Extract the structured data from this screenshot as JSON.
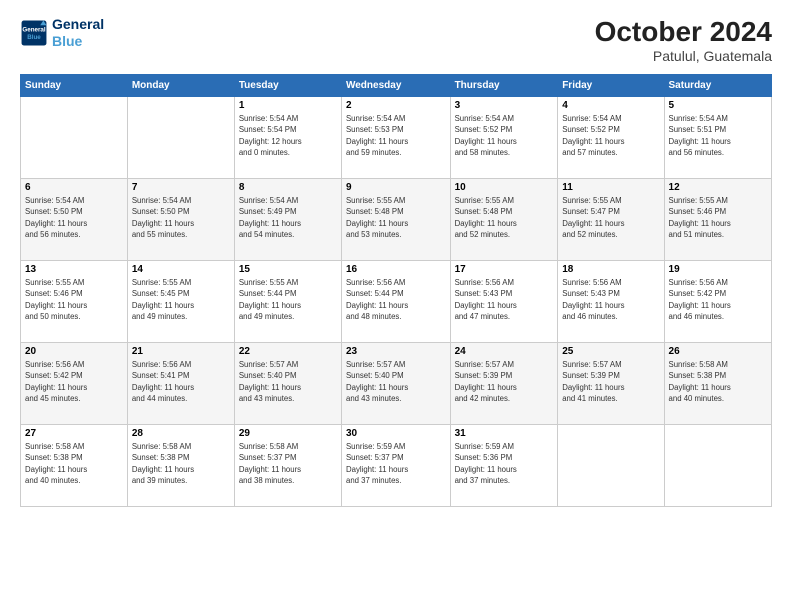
{
  "header": {
    "logo_line1": "General",
    "logo_line2": "Blue",
    "month": "October 2024",
    "location": "Patulul, Guatemala"
  },
  "weekdays": [
    "Sunday",
    "Monday",
    "Tuesday",
    "Wednesday",
    "Thursday",
    "Friday",
    "Saturday"
  ],
  "weeks": [
    [
      {
        "day": "",
        "info": ""
      },
      {
        "day": "",
        "info": ""
      },
      {
        "day": "1",
        "info": "Sunrise: 5:54 AM\nSunset: 5:54 PM\nDaylight: 12 hours\nand 0 minutes."
      },
      {
        "day": "2",
        "info": "Sunrise: 5:54 AM\nSunset: 5:53 PM\nDaylight: 11 hours\nand 59 minutes."
      },
      {
        "day": "3",
        "info": "Sunrise: 5:54 AM\nSunset: 5:52 PM\nDaylight: 11 hours\nand 58 minutes."
      },
      {
        "day": "4",
        "info": "Sunrise: 5:54 AM\nSunset: 5:52 PM\nDaylight: 11 hours\nand 57 minutes."
      },
      {
        "day": "5",
        "info": "Sunrise: 5:54 AM\nSunset: 5:51 PM\nDaylight: 11 hours\nand 56 minutes."
      }
    ],
    [
      {
        "day": "6",
        "info": "Sunrise: 5:54 AM\nSunset: 5:50 PM\nDaylight: 11 hours\nand 56 minutes."
      },
      {
        "day": "7",
        "info": "Sunrise: 5:54 AM\nSunset: 5:50 PM\nDaylight: 11 hours\nand 55 minutes."
      },
      {
        "day": "8",
        "info": "Sunrise: 5:54 AM\nSunset: 5:49 PM\nDaylight: 11 hours\nand 54 minutes."
      },
      {
        "day": "9",
        "info": "Sunrise: 5:55 AM\nSunset: 5:48 PM\nDaylight: 11 hours\nand 53 minutes."
      },
      {
        "day": "10",
        "info": "Sunrise: 5:55 AM\nSunset: 5:48 PM\nDaylight: 11 hours\nand 52 minutes."
      },
      {
        "day": "11",
        "info": "Sunrise: 5:55 AM\nSunset: 5:47 PM\nDaylight: 11 hours\nand 52 minutes."
      },
      {
        "day": "12",
        "info": "Sunrise: 5:55 AM\nSunset: 5:46 PM\nDaylight: 11 hours\nand 51 minutes."
      }
    ],
    [
      {
        "day": "13",
        "info": "Sunrise: 5:55 AM\nSunset: 5:46 PM\nDaylight: 11 hours\nand 50 minutes."
      },
      {
        "day": "14",
        "info": "Sunrise: 5:55 AM\nSunset: 5:45 PM\nDaylight: 11 hours\nand 49 minutes."
      },
      {
        "day": "15",
        "info": "Sunrise: 5:55 AM\nSunset: 5:44 PM\nDaylight: 11 hours\nand 49 minutes."
      },
      {
        "day": "16",
        "info": "Sunrise: 5:56 AM\nSunset: 5:44 PM\nDaylight: 11 hours\nand 48 minutes."
      },
      {
        "day": "17",
        "info": "Sunrise: 5:56 AM\nSunset: 5:43 PM\nDaylight: 11 hours\nand 47 minutes."
      },
      {
        "day": "18",
        "info": "Sunrise: 5:56 AM\nSunset: 5:43 PM\nDaylight: 11 hours\nand 46 minutes."
      },
      {
        "day": "19",
        "info": "Sunrise: 5:56 AM\nSunset: 5:42 PM\nDaylight: 11 hours\nand 46 minutes."
      }
    ],
    [
      {
        "day": "20",
        "info": "Sunrise: 5:56 AM\nSunset: 5:42 PM\nDaylight: 11 hours\nand 45 minutes."
      },
      {
        "day": "21",
        "info": "Sunrise: 5:56 AM\nSunset: 5:41 PM\nDaylight: 11 hours\nand 44 minutes."
      },
      {
        "day": "22",
        "info": "Sunrise: 5:57 AM\nSunset: 5:40 PM\nDaylight: 11 hours\nand 43 minutes."
      },
      {
        "day": "23",
        "info": "Sunrise: 5:57 AM\nSunset: 5:40 PM\nDaylight: 11 hours\nand 43 minutes."
      },
      {
        "day": "24",
        "info": "Sunrise: 5:57 AM\nSunset: 5:39 PM\nDaylight: 11 hours\nand 42 minutes."
      },
      {
        "day": "25",
        "info": "Sunrise: 5:57 AM\nSunset: 5:39 PM\nDaylight: 11 hours\nand 41 minutes."
      },
      {
        "day": "26",
        "info": "Sunrise: 5:58 AM\nSunset: 5:38 PM\nDaylight: 11 hours\nand 40 minutes."
      }
    ],
    [
      {
        "day": "27",
        "info": "Sunrise: 5:58 AM\nSunset: 5:38 PM\nDaylight: 11 hours\nand 40 minutes."
      },
      {
        "day": "28",
        "info": "Sunrise: 5:58 AM\nSunset: 5:38 PM\nDaylight: 11 hours\nand 39 minutes."
      },
      {
        "day": "29",
        "info": "Sunrise: 5:58 AM\nSunset: 5:37 PM\nDaylight: 11 hours\nand 38 minutes."
      },
      {
        "day": "30",
        "info": "Sunrise: 5:59 AM\nSunset: 5:37 PM\nDaylight: 11 hours\nand 37 minutes."
      },
      {
        "day": "31",
        "info": "Sunrise: 5:59 AM\nSunset: 5:36 PM\nDaylight: 11 hours\nand 37 minutes."
      },
      {
        "day": "",
        "info": ""
      },
      {
        "day": "",
        "info": ""
      }
    ]
  ]
}
